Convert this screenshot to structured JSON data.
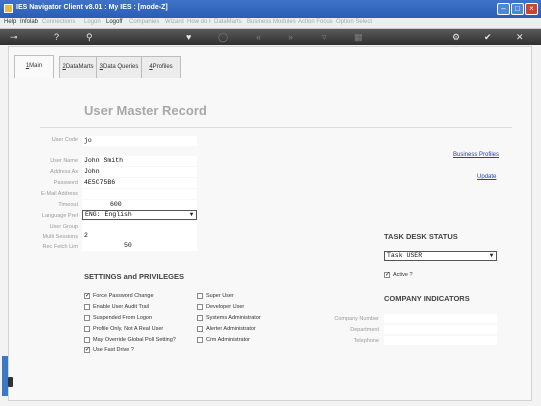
{
  "app": {
    "title": "IES Navigator Client v8.01 : My IES :      [mode-Z]"
  },
  "menu": [
    "Help",
    "Infolab",
    "Connections",
    "Logon",
    "Logoff",
    "Companies",
    "Wizard",
    "How do I",
    "DataMarts",
    "Business Modules",
    "Action Focus",
    "Option Select"
  ],
  "toolbar": {
    "icons": [
      "key-icon",
      "help-icon",
      "search-icon",
      "heart-icon",
      "ring-icon",
      "back-icon",
      "forward-icon",
      "filter-icon",
      "grid-icon",
      "gear-icon",
      "check-icon",
      "close-icon"
    ]
  },
  "tabs": [
    {
      "key": "1",
      "label": "Main"
    },
    {
      "key": "2",
      "label": "DataMarts"
    },
    {
      "key": "3",
      "label": "Data Queries"
    },
    {
      "key": "4",
      "label": "Profiles"
    }
  ],
  "page": {
    "title": "User Master Record"
  },
  "fields": {
    "user_code": {
      "label": "User Code",
      "value": "jo"
    },
    "user_name": {
      "label": "User Name",
      "value": "John Smith"
    },
    "address_as": {
      "label": "Address As",
      "value": "John"
    },
    "password": {
      "label": "Password",
      "value": "4E5C75B6"
    },
    "email": {
      "label": "E-Mail Address",
      "value": ""
    },
    "timeout": {
      "label": "Timeout",
      "value": "600"
    },
    "language": {
      "label": "Language Pref",
      "value": "ENG: English"
    },
    "user_group": {
      "label": "User Group",
      "value": ""
    },
    "multi_sessions": {
      "label": "Multi Sessions",
      "value": "2"
    },
    "rec_fetch": {
      "label": "Rec Fetch Lim",
      "value": "50"
    }
  },
  "links": {
    "business_profiles": "Business Profiles",
    "update": "Update"
  },
  "settings": {
    "title": "SETTINGS and PRIVILEGES",
    "left": [
      {
        "label": "Force Password Change",
        "checked": true
      },
      {
        "label": "Enable User Audit Trail",
        "checked": false
      },
      {
        "label": "Suspended From Logon",
        "checked": false
      },
      {
        "label": "Profile Only, Not A Real User",
        "checked": false
      },
      {
        "label": "May Override Global Poll Setting?",
        "checked": false
      },
      {
        "label": "Use Fast Drive ?",
        "checked": true
      }
    ],
    "right": [
      {
        "label": "Super User",
        "checked": false
      },
      {
        "label": "Developer User",
        "checked": false
      },
      {
        "label": "Systems Administrator",
        "checked": false
      },
      {
        "label": "Alerter Administrator",
        "checked": false
      },
      {
        "label": "Crm Administrator",
        "checked": false
      }
    ]
  },
  "task_desk": {
    "title": "TASK DESK STATUS",
    "value": "Task USER",
    "active_label": "Active ?",
    "active_checked": true
  },
  "company": {
    "title": "COMPANY INDICATORS",
    "number_label": "Company Number",
    "department_label": "Department",
    "telephone_label": "Telephone"
  }
}
